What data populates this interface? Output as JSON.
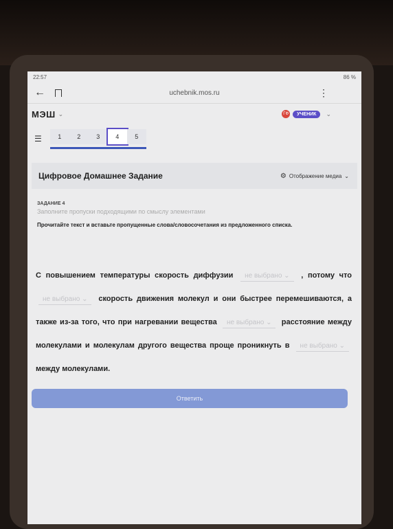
{
  "status": {
    "time": "22:57",
    "battery": "86 %"
  },
  "browser": {
    "url": "uchebnik.mos.ru"
  },
  "app": {
    "logo": "МЭШ",
    "avatar_initials": "ГФ",
    "role": "УЧЕНИК"
  },
  "tasks": {
    "tabs": [
      "1",
      "2",
      "3",
      "4",
      "5"
    ],
    "active": "4"
  },
  "card": {
    "title": "Цифровое Домашнее Задание",
    "media_toggle": "Отображение медиа"
  },
  "task": {
    "label": "ЗАДАНИЕ 4",
    "hint": "Заполните пропуски подходящими по смыслу элементами",
    "instruction": "Прочитайте текст и вставьте пропущенные слова/словосочетания из предложенного списка."
  },
  "passage": {
    "part1": "С повышением температуры скорость диффузии",
    "part2": ", потому что",
    "part3": "скорость движения молекул и они быстрее перемешиваются, а также из-за того, что при нагревании вещества",
    "part4": "расстояние между молекулами и молекулам другого вещества проще проникнуть в",
    "part5": "между молекулами.",
    "blank_placeholder": "не выбрано"
  },
  "submit": {
    "label": "Ответить"
  },
  "colors": {
    "accent": "#5b4ec7",
    "submit": "#8399d6",
    "tabs_underline": "#3c57b8"
  }
}
